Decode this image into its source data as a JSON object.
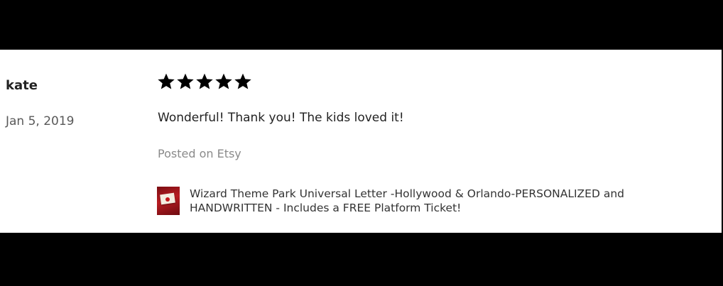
{
  "review": {
    "reviewer_name": "kate",
    "date": "Jan 5, 2019",
    "rating": 5,
    "stars_icon": "star-icon",
    "text": "Wonderful! Thank you! The kids loved it!",
    "posted_on": "Posted on Etsy",
    "listing": {
      "thumbnail_icon": "listing-thumbnail",
      "title": "Wizard Theme Park Universal Letter -Hollywood & Orlando-PERSONALIZED and HANDWRITTEN - Includes a FREE Platform Ticket!"
    }
  },
  "colors": {
    "background_frame": "#000000",
    "card": "#ffffff",
    "primary_text": "#222222",
    "muted_text": "#8a8a8a",
    "star": "#000000"
  }
}
